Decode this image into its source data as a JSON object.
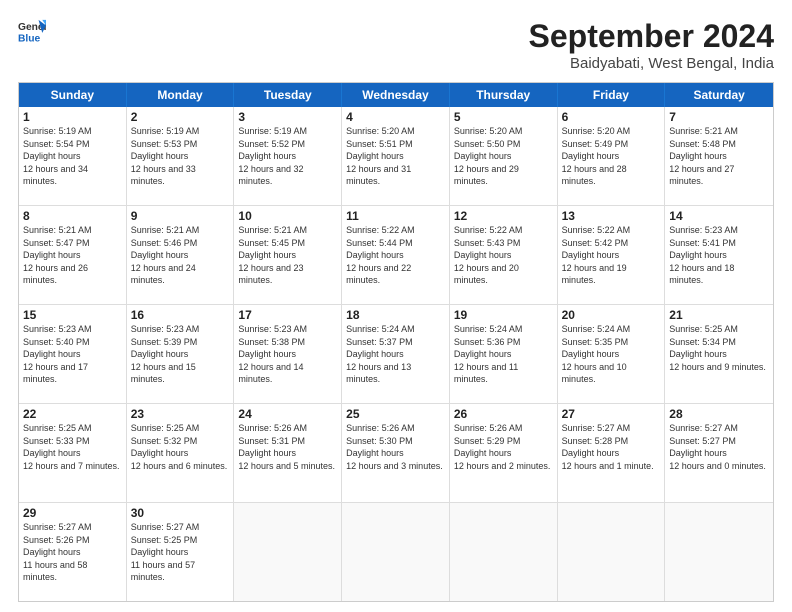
{
  "header": {
    "logo_line1": "General",
    "logo_line2": "Blue",
    "title": "September 2024",
    "subtitle": "Baidyabati, West Bengal, India"
  },
  "days_of_week": [
    "Sunday",
    "Monday",
    "Tuesday",
    "Wednesday",
    "Thursday",
    "Friday",
    "Saturday"
  ],
  "weeks": [
    [
      {
        "day": 1,
        "sunrise": "5:19 AM",
        "sunset": "5:54 PM",
        "daylight": "12 hours and 34 minutes."
      },
      {
        "day": 2,
        "sunrise": "5:19 AM",
        "sunset": "5:53 PM",
        "daylight": "12 hours and 33 minutes."
      },
      {
        "day": 3,
        "sunrise": "5:19 AM",
        "sunset": "5:52 PM",
        "daylight": "12 hours and 32 minutes."
      },
      {
        "day": 4,
        "sunrise": "5:20 AM",
        "sunset": "5:51 PM",
        "daylight": "12 hours and 31 minutes."
      },
      {
        "day": 5,
        "sunrise": "5:20 AM",
        "sunset": "5:50 PM",
        "daylight": "12 hours and 29 minutes."
      },
      {
        "day": 6,
        "sunrise": "5:20 AM",
        "sunset": "5:49 PM",
        "daylight": "12 hours and 28 minutes."
      },
      {
        "day": 7,
        "sunrise": "5:21 AM",
        "sunset": "5:48 PM",
        "daylight": "12 hours and 27 minutes."
      }
    ],
    [
      {
        "day": 8,
        "sunrise": "5:21 AM",
        "sunset": "5:47 PM",
        "daylight": "12 hours and 26 minutes."
      },
      {
        "day": 9,
        "sunrise": "5:21 AM",
        "sunset": "5:46 PM",
        "daylight": "12 hours and 24 minutes."
      },
      {
        "day": 10,
        "sunrise": "5:21 AM",
        "sunset": "5:45 PM",
        "daylight": "12 hours and 23 minutes."
      },
      {
        "day": 11,
        "sunrise": "5:22 AM",
        "sunset": "5:44 PM",
        "daylight": "12 hours and 22 minutes."
      },
      {
        "day": 12,
        "sunrise": "5:22 AM",
        "sunset": "5:43 PM",
        "daylight": "12 hours and 20 minutes."
      },
      {
        "day": 13,
        "sunrise": "5:22 AM",
        "sunset": "5:42 PM",
        "daylight": "12 hours and 19 minutes."
      },
      {
        "day": 14,
        "sunrise": "5:23 AM",
        "sunset": "5:41 PM",
        "daylight": "12 hours and 18 minutes."
      }
    ],
    [
      {
        "day": 15,
        "sunrise": "5:23 AM",
        "sunset": "5:40 PM",
        "daylight": "12 hours and 17 minutes."
      },
      {
        "day": 16,
        "sunrise": "5:23 AM",
        "sunset": "5:39 PM",
        "daylight": "12 hours and 15 minutes."
      },
      {
        "day": 17,
        "sunrise": "5:23 AM",
        "sunset": "5:38 PM",
        "daylight": "12 hours and 14 minutes."
      },
      {
        "day": 18,
        "sunrise": "5:24 AM",
        "sunset": "5:37 PM",
        "daylight": "12 hours and 13 minutes."
      },
      {
        "day": 19,
        "sunrise": "5:24 AM",
        "sunset": "5:36 PM",
        "daylight": "12 hours and 11 minutes."
      },
      {
        "day": 20,
        "sunrise": "5:24 AM",
        "sunset": "5:35 PM",
        "daylight": "12 hours and 10 minutes."
      },
      {
        "day": 21,
        "sunrise": "5:25 AM",
        "sunset": "5:34 PM",
        "daylight": "12 hours and 9 minutes."
      }
    ],
    [
      {
        "day": 22,
        "sunrise": "5:25 AM",
        "sunset": "5:33 PM",
        "daylight": "12 hours and 7 minutes."
      },
      {
        "day": 23,
        "sunrise": "5:25 AM",
        "sunset": "5:32 PM",
        "daylight": "12 hours and 6 minutes."
      },
      {
        "day": 24,
        "sunrise": "5:26 AM",
        "sunset": "5:31 PM",
        "daylight": "12 hours and 5 minutes."
      },
      {
        "day": 25,
        "sunrise": "5:26 AM",
        "sunset": "5:30 PM",
        "daylight": "12 hours and 3 minutes."
      },
      {
        "day": 26,
        "sunrise": "5:26 AM",
        "sunset": "5:29 PM",
        "daylight": "12 hours and 2 minutes."
      },
      {
        "day": 27,
        "sunrise": "5:27 AM",
        "sunset": "5:28 PM",
        "daylight": "12 hours and 1 minute."
      },
      {
        "day": 28,
        "sunrise": "5:27 AM",
        "sunset": "5:27 PM",
        "daylight": "12 hours and 0 minutes."
      }
    ],
    [
      {
        "day": 29,
        "sunrise": "5:27 AM",
        "sunset": "5:26 PM",
        "daylight": "11 hours and 58 minutes."
      },
      {
        "day": 30,
        "sunrise": "5:27 AM",
        "sunset": "5:25 PM",
        "daylight": "11 hours and 57 minutes."
      },
      null,
      null,
      null,
      null,
      null
    ]
  ]
}
